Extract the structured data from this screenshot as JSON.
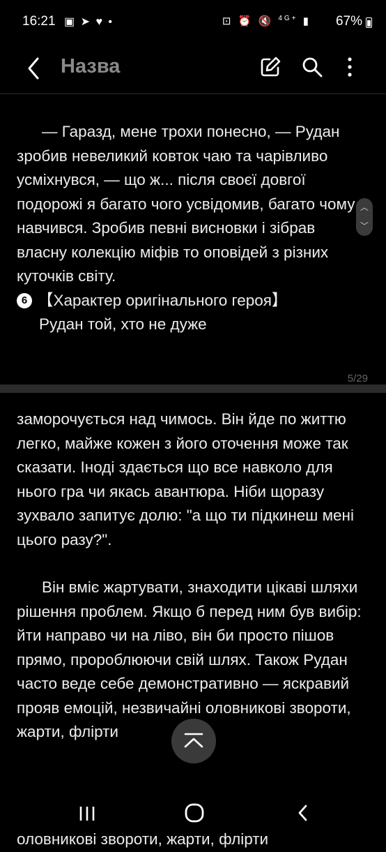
{
  "status_bar": {
    "time": "16:21",
    "left_icons": [
      "gallery-icon",
      "telegram-icon",
      "heart-icon",
      "dot-icon"
    ],
    "network": "4G+",
    "battery": "67%"
  },
  "header": {
    "title": "Назва"
  },
  "page1": {
    "paragraph": "— Гаразд, мене трохи понесно, — Рудан зробив невеликий ковток чаю та чарівливо усміхнувся, — що ж... після своєї довгої подорожі я багато чого усвідомив, багато чому навчився. Зробив певні висновки і зібрав власну колекцію міфів то оповідей з різних куточків світу.",
    "heading_number": "6",
    "heading": "【Характер оригінального героя】",
    "continuation": "Рудан той, хто не дуже"
  },
  "page_indicator": "5/29",
  "page2": {
    "paragraph1": "заморочується над чимось. Він йде по життю легко, майже кожен з його оточення може так сказати. Іноді здається що все навколо для нього гра чи якась авантюра. Ніби щоразу зухвало запитує долю: \"а що ти підкинеш мені цього разу?\".",
    "paragraph2": "Він вміє жартувати, знаходити цікаві шляхи рішення проблем. Якщо б перед ним був вибір: йти направо чи на ліво, він би просто пішов прямо, пророблюючи свій шлях. Також Рудан часто веде себе демонстративно — яскравий прояв емоцій, незвичайні оловникові звороти, жарти, флірти"
  },
  "ghost_line": "оловникові звороти, жарти, флірти",
  "colors": {
    "background": "#000000",
    "text": "#ededed",
    "title": "#8a8a8a",
    "separator": "#2b2b2b"
  }
}
